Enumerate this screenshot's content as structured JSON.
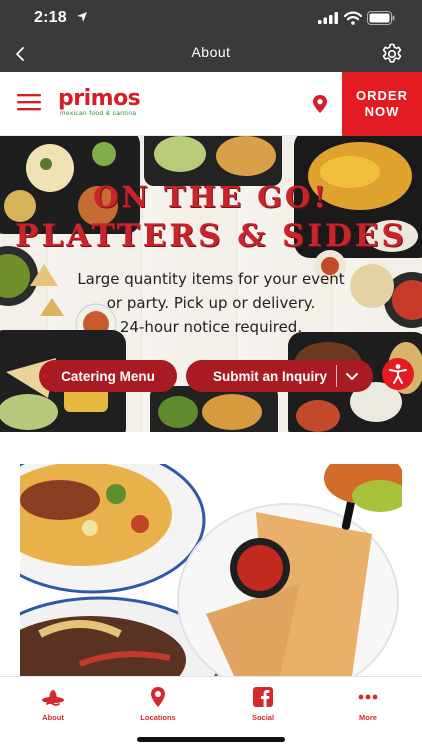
{
  "status_bar": {
    "time": "2:18"
  },
  "nav_bar": {
    "title": "About"
  },
  "header": {
    "logo_text": "primos",
    "logo_tagline": "mexican food & cantina",
    "order_now_label": "ORDER NOW"
  },
  "hero": {
    "title_line_1": "ON THE GO!",
    "title_line_2": "PLATTERS & SIDES",
    "body_lines": [
      "Large quantity items for your event",
      "or party. Pick up or delivery.",
      "24-hour notice required."
    ],
    "catering_button": "Catering Menu",
    "inquiry_button": "Submit an Inquiry"
  },
  "tab_bar": {
    "items": [
      {
        "label": "About",
        "icon": "sombrero-icon"
      },
      {
        "label": "Locations",
        "icon": "map-pin-icon"
      },
      {
        "label": "Social",
        "icon": "facebook-icon"
      },
      {
        "label": "More",
        "icon": "more-dots-icon"
      }
    ]
  },
  "colors": {
    "brand_red": "#e31b23",
    "button_dark_red": "#a91b22",
    "tab_red": "#d42a2f",
    "bar_gray": "#3a3a3c"
  }
}
